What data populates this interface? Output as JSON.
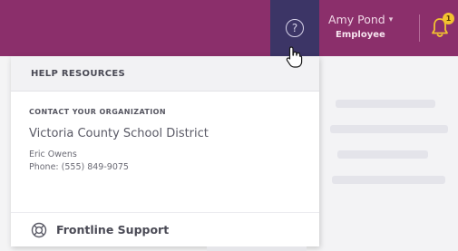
{
  "header": {
    "help_icon_glyph": "?",
    "user": {
      "name": "Amy Pond",
      "dropdown_glyph": "▾",
      "role": "Employee"
    },
    "notifications": {
      "icon": "bell-icon",
      "badge_count": "1"
    }
  },
  "help_panel": {
    "title": "HELP RESOURCES",
    "contact_section": {
      "title": "CONTACT YOUR ORGANIZATION",
      "organization": "Victoria County School District",
      "contact_name": "Eric Owens",
      "contact_phone": "Phone: (555) 849-9075"
    },
    "support_link": {
      "icon": "lifebuoy-icon",
      "label": "Frontline Support"
    }
  },
  "colors": {
    "topbar": "#8b2f6b",
    "help_button_active": "#3c3566",
    "badge": "#f2c230",
    "panel_header": "#f2f2f4"
  }
}
